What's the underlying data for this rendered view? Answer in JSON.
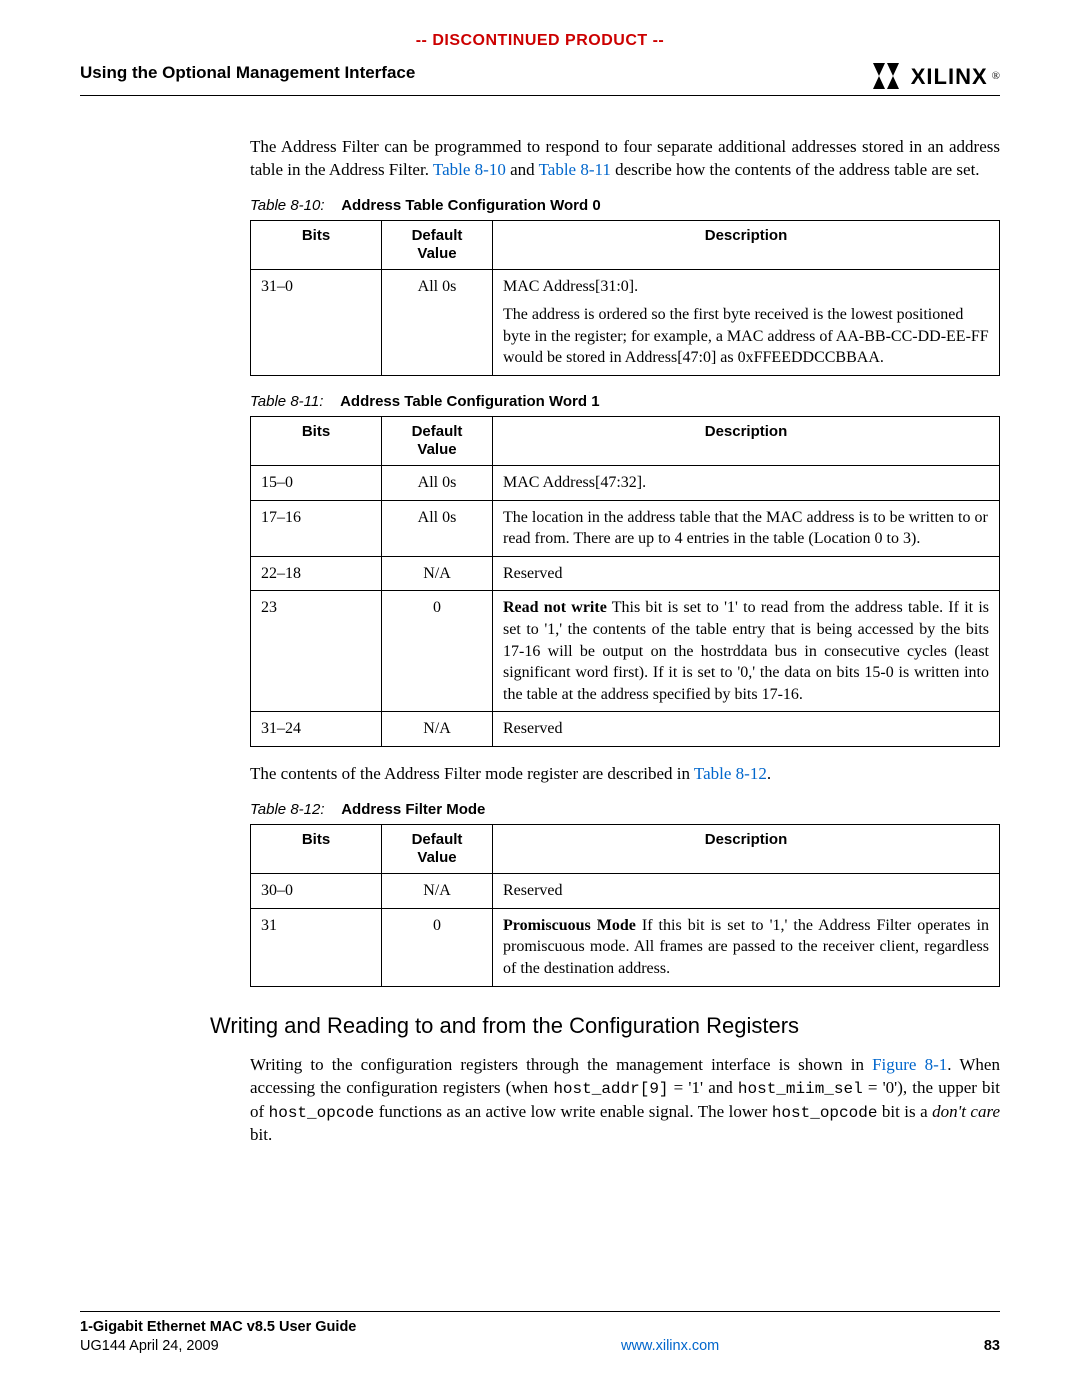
{
  "banner": "-- DISCONTINUED PRODUCT --",
  "section_title": "Using the Optional Management Interface",
  "logo_text": "XILINX",
  "intro_para_parts": {
    "a": "The Address Filter can be programmed to respond to four separate additional addresses stored in an address table in the Address Filter. ",
    "ref1": "Table 8-10",
    "b": " and ",
    "ref2": "Table 8-11",
    "c": " describe how the contents of the address table are set."
  },
  "headers": {
    "bits": "Bits",
    "default": "Default Value",
    "desc": "Description"
  },
  "table10": {
    "caption_num": "Table 8-10:",
    "caption_title": "Address Table Configuration Word 0",
    "rows": [
      {
        "bits": "31–0",
        "def": "All 0s",
        "desc_l1": "MAC Address[31:0].",
        "desc_l2": "The address is ordered so the first byte received is the lowest positioned byte in the register; for example, a MAC address of AA-BB-CC-DD-EE-FF would be stored in Address[47:0] as 0xFFEEDDCCBBAA."
      }
    ]
  },
  "table11": {
    "caption_num": "Table 8-11:",
    "caption_title": "Address Table Configuration Word 1",
    "rows": [
      {
        "bits": "15–0",
        "def": "All 0s",
        "desc": "MAC Address[47:32]."
      },
      {
        "bits": "17–16",
        "def": "All 0s",
        "desc": "The location in the address table that the MAC address is to be written to or read from. There are up to 4 entries in the table (Location 0 to 3)."
      },
      {
        "bits": "22–18",
        "def": "N/A",
        "desc": "Reserved"
      },
      {
        "bits": "23",
        "def": "0",
        "lead": "Read not write",
        "desc": " This bit is set to '1' to read from the address table. If it is set to '1,' the contents of the table entry that is being accessed by the bits 17-16 will be output on the hostrddata bus in consecutive cycles (least significant word first). If it is set to '0,' the data on bits 15-0 is written into the table at the address specified by bits 17-16."
      },
      {
        "bits": "31–24",
        "def": "N/A",
        "desc": "Reserved"
      }
    ]
  },
  "mid_para_parts": {
    "a": "The contents of the Address Filter mode register are described in ",
    "ref": "Table 8-12",
    "b": "."
  },
  "table12": {
    "caption_num": "Table 8-12:",
    "caption_title": "Address Filter Mode",
    "rows": [
      {
        "bits": "30–0",
        "def": "N/A",
        "desc": "Reserved"
      },
      {
        "bits": "31",
        "def": "0",
        "lead": "Promiscuous Mode",
        "desc": " If this bit is set to '1,' the Address Filter operates in promiscuous mode. All frames are passed to the receiver client, regardless of the destination address."
      }
    ]
  },
  "h2": "Writing and Reading to and from the Configuration Registers",
  "wr_para_parts": {
    "a": "Writing to the configuration registers through the management interface is shown in ",
    "ref": "Figure 8-1",
    "b": ". When accessing the configuration registers (when ",
    "code1": "host_addr[9]",
    "c": " = '1' and ",
    "code2": "host_miim_sel",
    "d": " = '0'), the upper bit of ",
    "code3": "host_opcode",
    "e": " functions as an active low write enable signal. The lower ",
    "code4": "host_opcode",
    "f": " bit is a ",
    "ital": "don't care",
    "g": " bit."
  },
  "footer": {
    "left_l1": "1-Gigabit Ethernet MAC v8.5 User Guide",
    "left_l2": "UG144 April 24, 2009",
    "center": "www.xilinx.com",
    "right": "83"
  }
}
